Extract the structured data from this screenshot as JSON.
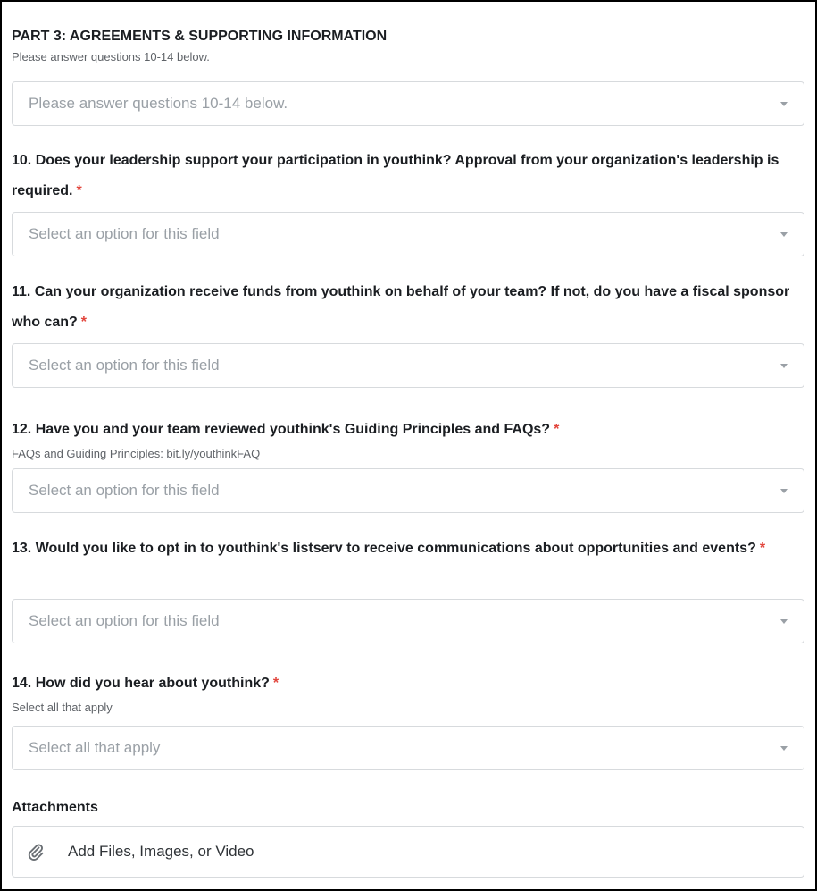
{
  "part3": {
    "title": "PART 3: AGREEMENTS & SUPPORTING INFORMATION",
    "help": "Please answer questions 10-14 below.",
    "select_placeholder": "Please answer questions 10-14 below."
  },
  "questions": [
    {
      "label": "10. Does your leadership support your participation in youthink? Approval from your organization's leadership is required.",
      "required_mark": "*",
      "placeholder": "Select an option for this field"
    },
    {
      "label": "11. Can your organization receive funds from youthink on behalf of your team? If not, do you have a fiscal sponsor who can?",
      "required_mark": "*",
      "placeholder": "Select an option for this field"
    },
    {
      "label": "12. Have you and your team reviewed youthink's Guiding Principles and FAQs?",
      "required_mark": "*",
      "help": "FAQs and Guiding Principles: bit.ly/youthinkFAQ",
      "placeholder": "Select an option for this field"
    },
    {
      "label": "13. Would you like to opt in to youthink's listserv to receive communications about opportunities and events?",
      "required_mark": "*",
      "placeholder": "Select an option for this field"
    },
    {
      "label": "14. How did you hear about youthink?",
      "required_mark": "*",
      "help": "Select all that apply",
      "placeholder": "Select all that apply"
    }
  ],
  "attachments": {
    "label": "Attachments",
    "button_label": "Add Files, Images, or Video",
    "icon": "paperclip-icon"
  },
  "colors": {
    "required": "#e2453c",
    "border": "#d7dadd",
    "placeholder": "#9aa0a6"
  }
}
